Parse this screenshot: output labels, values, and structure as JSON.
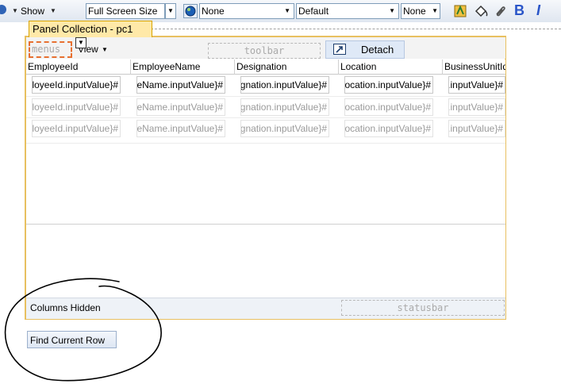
{
  "toolbar": {
    "show_label": "Show",
    "screen_size": "Full Screen Size",
    "skin": "None",
    "style": "Default",
    "accessibility": "None",
    "bold_label": "B",
    "italic_label": "I"
  },
  "panel": {
    "title": "Panel Collection - pc1",
    "menus_placeholder": "menus",
    "view_menu": "View",
    "toolbar_placeholder": "toolbar",
    "detach_label": "Detach",
    "statusbar_placeholder": "statusbar",
    "columns_hidden": "Columns Hidden"
  },
  "table": {
    "columns": [
      "EmployeeId",
      "EmployeeName",
      "Designation",
      "Location",
      "BusinessUnitId"
    ],
    "rows": [
      [
        "#{row.EmployeeId.inputValue}",
        "#{row.EmployeeName.inputValue}",
        "#{row.Designation.inputValue}",
        "#{row.Location.inputValue}",
        "#{row.BusinessUnitId.inputValue}"
      ],
      [
        "#{row.EmployeeId.inputValue}",
        "#{row.EmployeeName.inputValue}",
        "#{row.Designation.inputValue}",
        "#{row.Location.inputValue}",
        "#{row.BusinessUnitId.inputValue}"
      ],
      [
        "#{row.EmployeeId.inputValue}",
        "#{row.EmployeeName.inputValue}",
        "#{row.Designation.inputValue}",
        "#{row.Location.inputValue}",
        "#{row.BusinessUnitId.inputValue}"
      ]
    ]
  },
  "actions": {
    "find_current_row": "Find Current Row"
  },
  "colors": {
    "panel_border": "#e8c060",
    "tab_background": "#ffe9a8",
    "detach_background": "#dfe9f7",
    "annotation": "#000000"
  }
}
